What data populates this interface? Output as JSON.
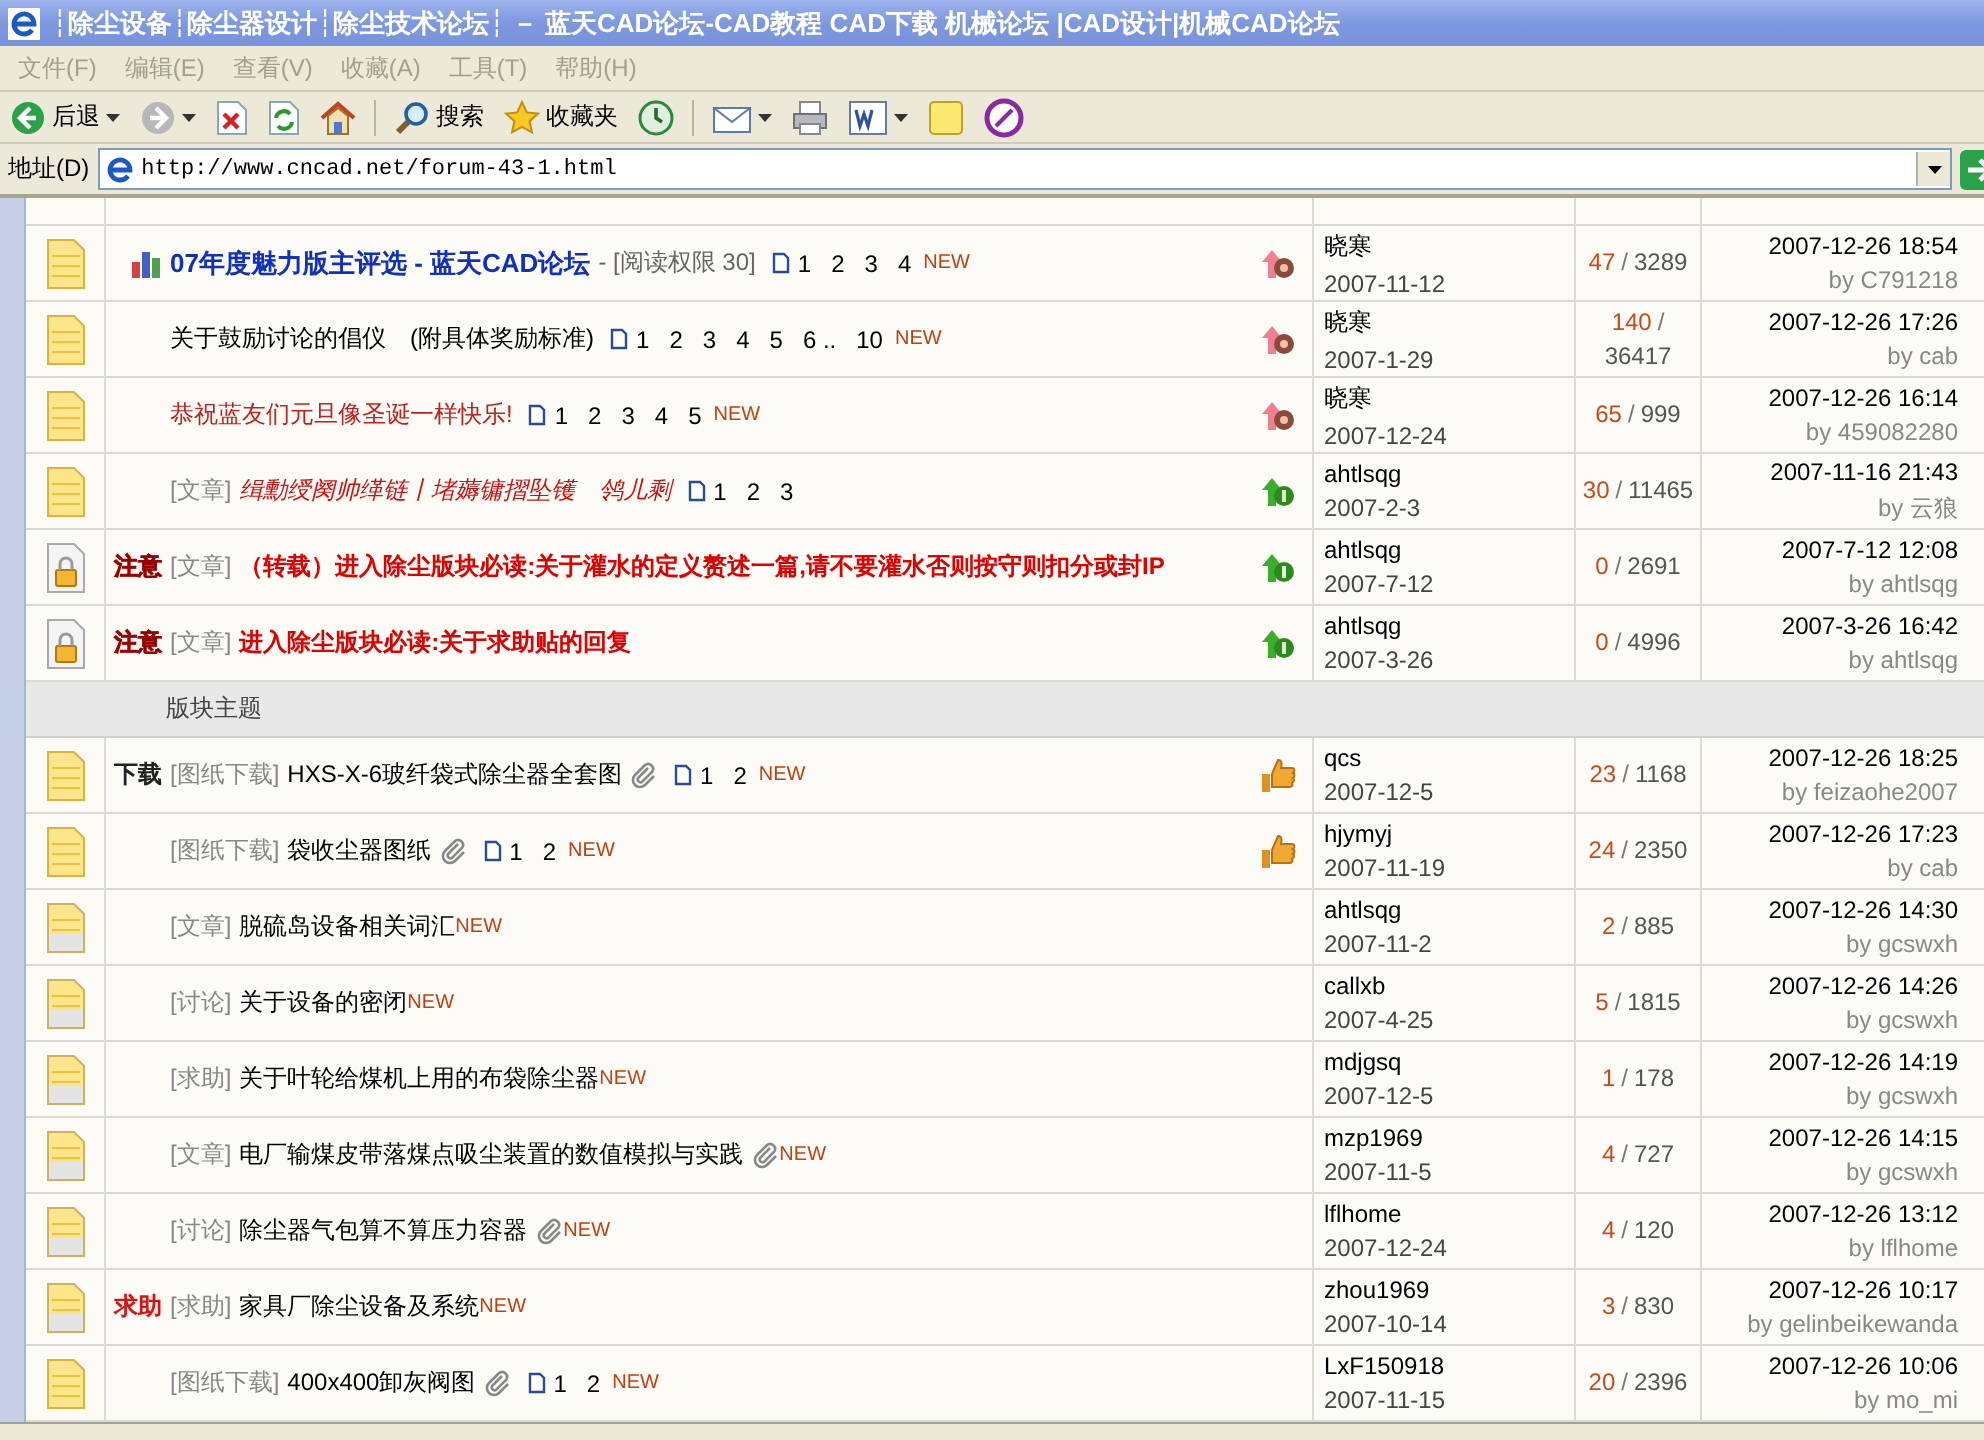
{
  "window": {
    "title": "┆除尘设备┆除尘器设计┆除尘技术论坛┆ － 蓝天CAD论坛-CAD教程 CAD下载 机械论坛 |CAD设计|机械CAD论坛"
  },
  "menu": [
    "文件(F)",
    "编辑(E)",
    "查看(V)",
    "收藏(A)",
    "工具(T)",
    "帮助(H)"
  ],
  "toolbar": [
    {
      "kind": "back",
      "label": "后退",
      "menu": true
    },
    {
      "kind": "forward",
      "menu": true
    },
    {
      "kind": "stop"
    },
    {
      "kind": "refresh"
    },
    {
      "kind": "home"
    },
    {
      "kind": "separator"
    },
    {
      "kind": "search",
      "label": "搜索"
    },
    {
      "kind": "favorites",
      "label": "收藏夹"
    },
    {
      "kind": "history"
    },
    {
      "kind": "separator"
    },
    {
      "kind": "mail",
      "menu": true
    },
    {
      "kind": "print"
    },
    {
      "kind": "edit",
      "menu": true
    },
    {
      "kind": "note"
    },
    {
      "kind": "messenger"
    }
  ],
  "address": {
    "label": "地址(D)",
    "value": "http://www.cncad.net/forum-43-1.html"
  },
  "sticky_topics": [
    {
      "folder": {
        "kind": "new"
      },
      "badge": {
        "kind": "poll"
      },
      "title": "07年度魅力版主评选 - 蓝天CAD论坛",
      "kind": "poll",
      "suffix": "- [阅读权限 30]",
      "pages": [
        "1",
        "2",
        "3",
        "4"
      ],
      "new_tag": "NEW",
      "pin": {
        "kind": "top3"
      },
      "author": "晓寒",
      "date": "2007-11-12",
      "replies": "47",
      "divider": "/",
      "views": "3289",
      "last_time": "2007-12-26 18:54",
      "last_by": "by C791218"
    },
    {
      "folder": {
        "kind": "new"
      },
      "title": "关于鼓励讨论的倡仪　(附具体奖励标准)",
      "kind": "plain",
      "pages": [
        "1",
        "2",
        "3",
        "4",
        "5",
        "6 ..",
        "10"
      ],
      "new_tag": "NEW",
      "pin": {
        "kind": "top3"
      },
      "author": "晓寒",
      "date": "2007-1-29",
      "replies": "140",
      "divider": "/",
      "views": "36417",
      "last_time": "2007-12-26 17:26",
      "last_by": "by cab"
    },
    {
      "folder": {
        "kind": "new"
      },
      "title": "恭祝蓝友们元旦像圣诞一样快乐!",
      "kind": "greeting",
      "pages": [
        "1",
        "2",
        "3",
        "4",
        "5"
      ],
      "new_tag": "NEW",
      "pin": {
        "kind": "top3"
      },
      "author": "晓寒",
      "date": "2007-12-24",
      "replies": "65",
      "divider": "/",
      "views": "999",
      "last_time": "2007-12-26 16:14",
      "last_by": "by 459082280"
    },
    {
      "folder": {
        "kind": "new"
      },
      "type": "[文章]",
      "title": "缉勳绶阕帅缂链丨堵薅镛摺坠镬　鸰儿剩",
      "kind": "garbled",
      "pages": [
        "1",
        "2",
        "3"
      ],
      "pin": {
        "kind": "top1"
      },
      "author": "ahtlsqg",
      "date": "2007-2-3",
      "replies": "30",
      "divider": "/",
      "views": "11465",
      "last_time": "2007-11-16 21:43",
      "last_by": "by 云狼"
    },
    {
      "folder": {
        "kind": "locked"
      },
      "badge": {
        "kind": "notice",
        "text": "注意"
      },
      "type": "[文章]",
      "title": "（转载）进入除尘版块必读:关于灌水的定义赘述一篇,请不要灌水否则按守则扣分或封IP",
      "kind": "notice",
      "pin": {
        "kind": "top1"
      },
      "author": "ahtlsqg",
      "date": "2007-7-12",
      "replies": "0",
      "divider": "/",
      "views": "2691",
      "last_time": "2007-7-12 12:08",
      "last_by": "by ahtlsqg"
    },
    {
      "folder": {
        "kind": "locked"
      },
      "badge": {
        "kind": "notice",
        "text": "注意"
      },
      "type": "[文章]",
      "title": "进入除尘版块必读:关于求助贴的回复",
      "kind": "notice",
      "pin": {
        "kind": "top1"
      },
      "author": "ahtlsqg",
      "date": "2007-3-26",
      "replies": "0",
      "divider": "/",
      "views": "4996",
      "last_time": "2007-3-26 16:42",
      "last_by": "by ahtlsqg"
    }
  ],
  "section_header": "版块主题",
  "topics": [
    {
      "folder": {
        "kind": "new"
      },
      "badge": {
        "kind": "download",
        "text": "下载"
      },
      "type": "[图纸下载]",
      "title": "HXS-X-6玻纤袋式除尘器全套图",
      "kind": "plain",
      "attachment": true,
      "pages": [
        "1",
        "2"
      ],
      "new_tag": "NEW",
      "pin": {
        "kind": "digest"
      },
      "author": "qcs",
      "date": "2007-12-5",
      "replies": "23",
      "divider": "/",
      "views": "1168",
      "last_time": "2007-12-26 18:25",
      "last_by": "by feizaohe2007"
    },
    {
      "folder": {
        "kind": "new"
      },
      "type": "[图纸下载]",
      "title": "袋收尘器图纸",
      "kind": "plain",
      "attachment": true,
      "pages": [
        "1",
        "2"
      ],
      "new_tag": "NEW",
      "pin": {
        "kind": "digest"
      },
      "author": "hjymyj",
      "date": "2007-11-19",
      "replies": "24",
      "divider": "/",
      "views": "2350",
      "last_time": "2007-12-26 17:23",
      "last_by": "by cab"
    },
    {
      "folder": {
        "kind": "read"
      },
      "type": "[文章]",
      "title": "脱硫岛设备相关词汇",
      "kind": "plain",
      "new_tag": "NEW",
      "author": "ahtlsqg",
      "date": "2007-11-2",
      "replies": "2",
      "divider": "/",
      "views": "885",
      "last_time": "2007-12-26 14:30",
      "last_by": "by gcswxh"
    },
    {
      "folder": {
        "kind": "read"
      },
      "type": "[讨论]",
      "title": "关于设备的密闭",
      "kind": "plain",
      "new_tag": "NEW",
      "author": "callxb",
      "date": "2007-4-25",
      "replies": "5",
      "divider": "/",
      "views": "1815",
      "last_time": "2007-12-26 14:26",
      "last_by": "by gcswxh"
    },
    {
      "folder": {
        "kind": "read"
      },
      "type": "[求助]",
      "title": "关于叶轮给煤机上用的布袋除尘器",
      "kind": "plain",
      "new_tag": "NEW",
      "author": "mdjgsq",
      "date": "2007-12-5",
      "replies": "1",
      "divider": "/",
      "views": "178",
      "last_time": "2007-12-26 14:19",
      "last_by": "by gcswxh"
    },
    {
      "folder": {
        "kind": "read"
      },
      "type": "[文章]",
      "title": "电厂输煤皮带落煤点吸尘装置的数值模拟与实践",
      "kind": "plain",
      "attachment": true,
      "new_tag": "NEW",
      "author": "mzp1969",
      "date": "2007-11-5",
      "replies": "4",
      "divider": "/",
      "views": "727",
      "last_time": "2007-12-26 14:15",
      "last_by": "by gcswxh"
    },
    {
      "folder": {
        "kind": "read"
      },
      "type": "[讨论]",
      "title": "除尘器气包算不算压力容器",
      "kind": "plain",
      "attachment": true,
      "new_tag": "NEW",
      "author": "lflhome",
      "date": "2007-12-24",
      "replies": "4",
      "divider": "/",
      "views": "120",
      "last_time": "2007-12-26 13:12",
      "last_by": "by lflhome"
    },
    {
      "folder": {
        "kind": "read"
      },
      "badge": {
        "kind": "help",
        "text": "求助"
      },
      "type": "[求助]",
      "title": "家具厂除尘设备及系统",
      "kind": "plain",
      "new_tag": "NEW",
      "author": "zhou1969",
      "date": "2007-10-14",
      "replies": "3",
      "divider": "/",
      "views": "830",
      "last_time": "2007-12-26 10:17",
      "last_by": "by gelinbeikewanda"
    },
    {
      "folder": {
        "kind": "new"
      },
      "type": "[图纸下载]",
      "title": "400x400卸灰阀图",
      "kind": "plain",
      "attachment": true,
      "pages": [
        "1",
        "2"
      ],
      "new_tag": "NEW",
      "author": "LxF150918",
      "date": "2007-11-15",
      "replies": "20",
      "divider": "/",
      "views": "2396",
      "last_time": "2007-12-26 10:06",
      "last_by": "by mo_mi"
    }
  ]
}
